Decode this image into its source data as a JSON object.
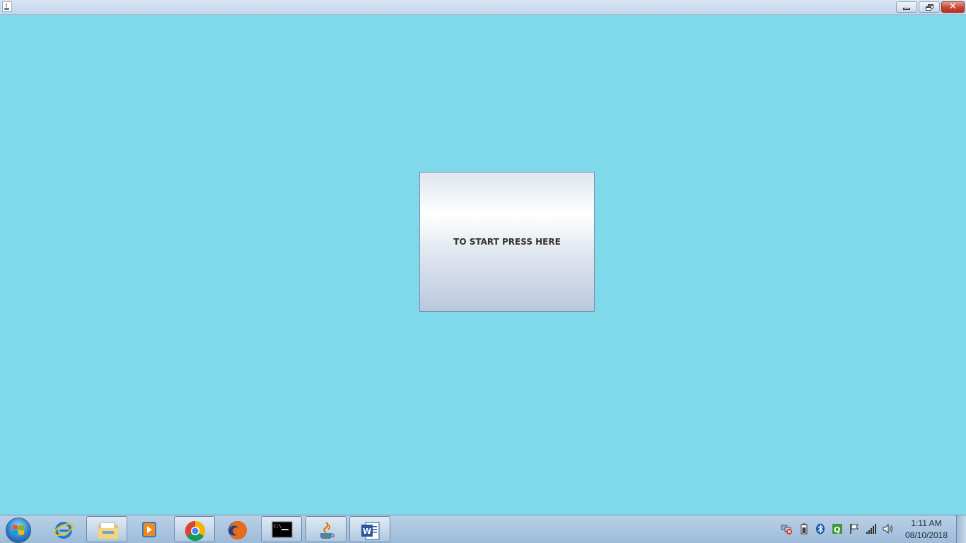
{
  "window": {
    "start_button_label": "TO START PRESS HERE",
    "background_color": "#80d9ea",
    "close_glyph": "✕"
  },
  "taskbar": {
    "start": "windows-start-orb",
    "pinned": [
      {
        "icon": "internet-explorer-icon",
        "running": false
      },
      {
        "icon": "file-explorer-icon",
        "running": true
      },
      {
        "icon": "media-player-icon",
        "running": false
      },
      {
        "icon": "chrome-icon",
        "running": true
      },
      {
        "icon": "firefox-icon",
        "running": false
      },
      {
        "icon": "command-prompt-icon",
        "running": true
      },
      {
        "icon": "java-icon",
        "running": true
      },
      {
        "icon": "word-icon",
        "running": true
      }
    ],
    "tray": [
      "network-error-icon",
      "battery-icon",
      "bluetooth-icon",
      "q-app-icon",
      "flag-icon",
      "signal-icon",
      "volume-icon"
    ],
    "clock": {
      "time": "1:11 AM",
      "date": "08/10/2018"
    }
  }
}
